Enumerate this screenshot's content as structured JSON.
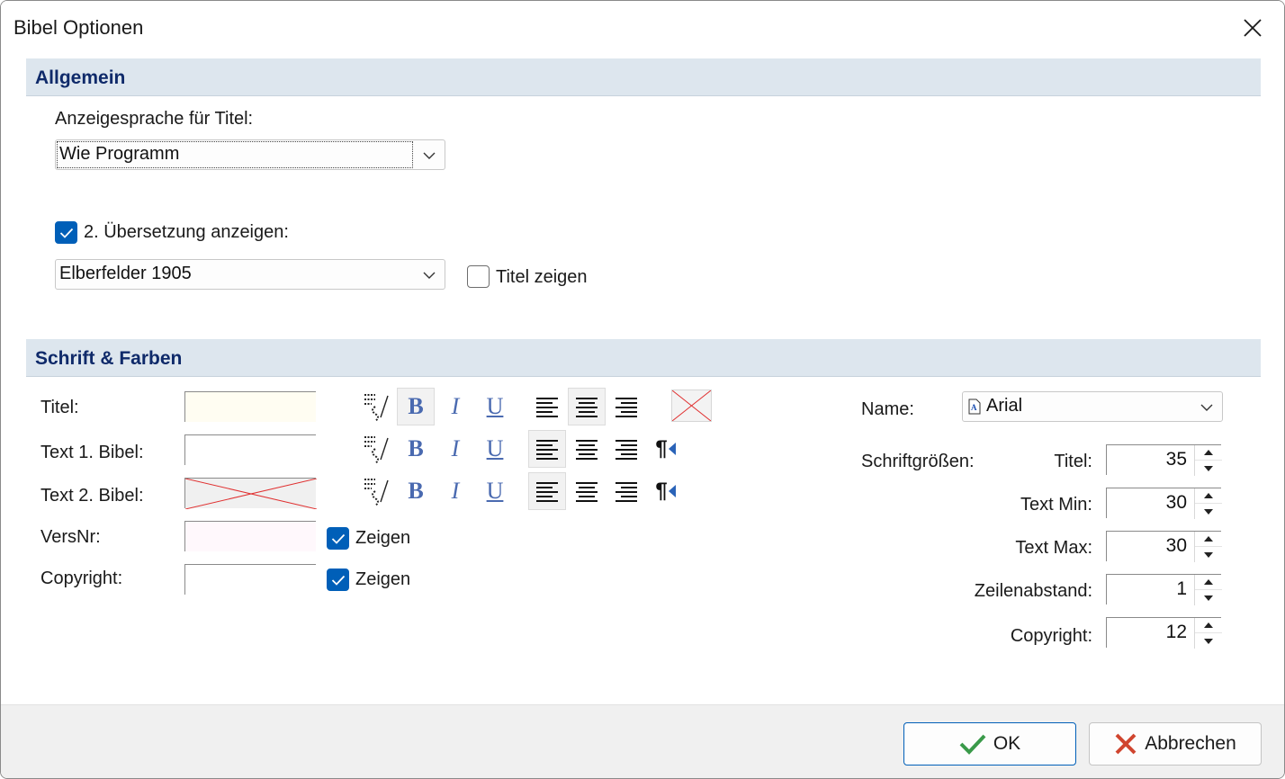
{
  "window": {
    "title": "Bibel Optionen"
  },
  "general": {
    "header": "Allgemein",
    "display_language_label": "Anzeigesprache für Titel:",
    "display_language_value": "Wie Programm",
    "second_translation_label": "2. Übersetzung anzeigen:",
    "second_translation_checked": true,
    "second_translation_value": "Elberfelder 1905",
    "show_title_label": "Titel zeigen",
    "show_title_checked": false
  },
  "fonts_colors": {
    "header": "Schrift & Farben",
    "rows": [
      {
        "label": "Titel:",
        "swatch_color": "#fffdf2"
      },
      {
        "label": "Text 1. Bibel:",
        "swatch_color": "#ffffff"
      },
      {
        "label": "Text 2. Bibel:",
        "swatch_color": "#f0f0f0"
      },
      {
        "label": "VersNr:",
        "swatch_color": "#fff8fc"
      },
      {
        "label": "Copyright:",
        "swatch_color": "#ffffff"
      }
    ],
    "show_label": "Zeigen",
    "versnr_show_checked": true,
    "copyright_show_checked": true,
    "toolbar_icons": [
      "text-format-icon",
      "bold-icon",
      "italic-icon",
      "underline-icon",
      "align-left-icon",
      "align-center-icon",
      "align-right-icon",
      "paragraph-direction-icon"
    ],
    "bold_glyph": "B",
    "italic_glyph": "I",
    "underline_glyph": "U",
    "pilcrow_glyph": "¶",
    "font_name_label": "Name:",
    "font_name_value": "Arial",
    "font_sizes_label": "Schriftgrößen:",
    "sizes": [
      {
        "label": "Titel:",
        "value": "35"
      },
      {
        "label": "Text Min:",
        "value": "30"
      },
      {
        "label": "Text Max:",
        "value": "30"
      },
      {
        "label": "Zeilenabstand:",
        "value": "1"
      },
      {
        "label": "Copyright:",
        "value": "12"
      }
    ]
  },
  "footer": {
    "ok_label": "OK",
    "cancel_label": "Abbrechen"
  },
  "colors": {
    "accent": "#005fb8",
    "header_bg": "#dde6ee",
    "header_text": "#0f2a6a",
    "ok_check": "#3a9a4a",
    "cancel_x": "#d0452f"
  }
}
